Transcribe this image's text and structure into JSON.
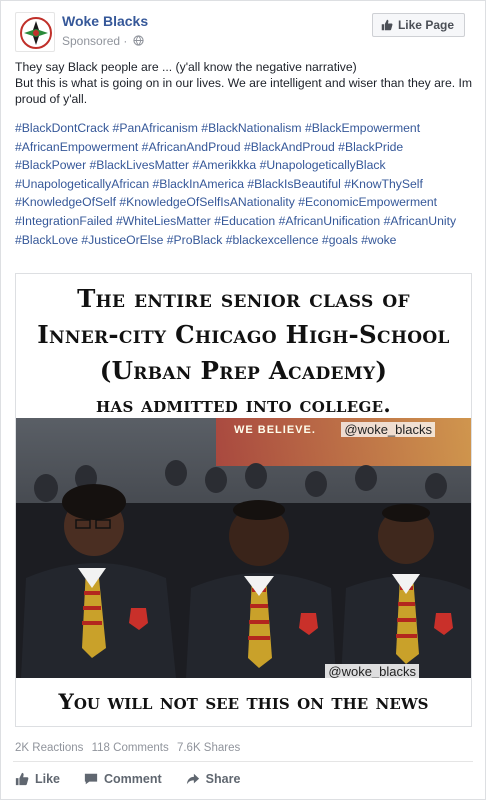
{
  "post": {
    "page_name": "Woke Blacks",
    "sponsored_label": "Sponsored",
    "like_page_label": "Like Page",
    "text_line1": "They say Black people are ... (y'all know the negative narrative)",
    "text_line2": "But this is what is going on in our lives. We are intelligent and wiser than they are. Im proud of y'all.",
    "hashtags": [
      "#BlackDontCrack",
      "#PanAfricanism",
      "#BlackNationalism",
      "#BlackEmpowerment",
      "#AfricanEmpowerment",
      "#AfricanAndProud",
      "#BlackAndProud",
      "#BlackPride",
      "#BlackPower",
      "#BlackLivesMatter",
      "#Amerikkka",
      "#UnapologeticallyBlack",
      "#UnapologeticallyAfrican",
      "#BlackInAmerica",
      "#BlackIsBeautiful",
      "#KnowThySelf",
      "#KnowledgeOfSelf",
      "#KnowledgeOfSelfIsANationality",
      "#EconomicEmpowerment",
      "#IntegrationFailed",
      "#WhiteLiesMatter",
      "#Education",
      "#AfricanUnification",
      "#AfricanUnity",
      "#BlackLove",
      "#JusticeOrElse",
      "#ProBlack",
      "#blackexcellence",
      "#goals",
      "#woke"
    ]
  },
  "image": {
    "headline_line1": "The entire senior class of",
    "headline_line2": "Inner-city Chicago High-School",
    "headline_line3": "(Urban Prep Academy)",
    "headline_line4": "has admitted into college.",
    "watermark": "@woke_blacks",
    "banner_text": "WE BELIEVE.",
    "footer": "You will not see this on the news"
  },
  "stats": {
    "reactions": "2K Reactions",
    "comments": "118 Comments",
    "shares": "7.6K Shares"
  },
  "actions": {
    "like": "Like",
    "comment": "Comment",
    "share": "Share"
  },
  "colors": {
    "link": "#365899",
    "meta": "#90949c",
    "action": "#606770"
  }
}
